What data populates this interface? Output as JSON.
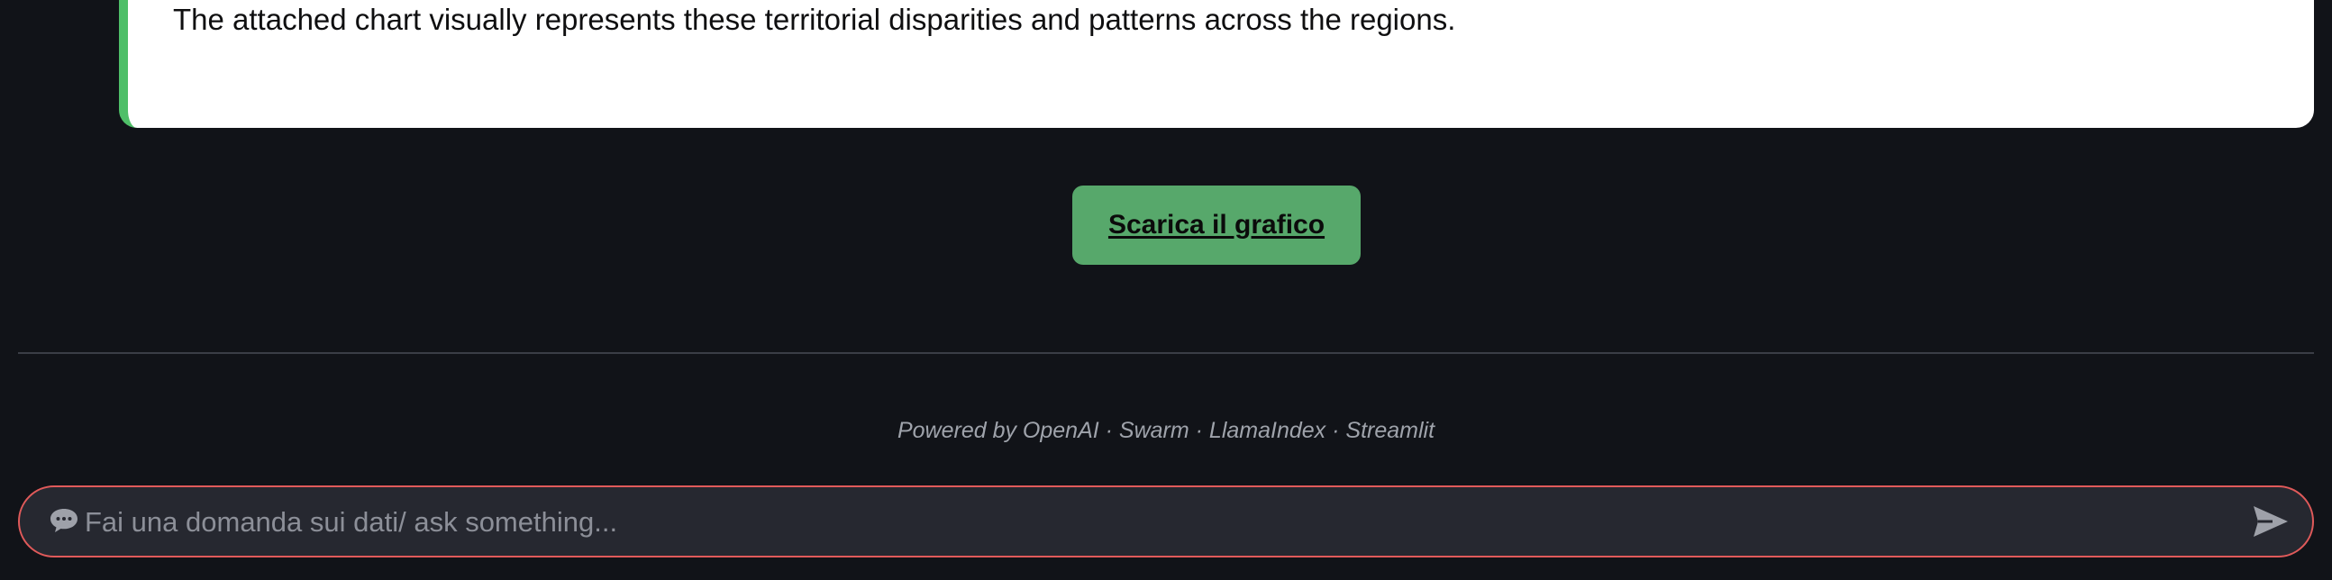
{
  "message": {
    "text": "The attached chart visually represents these territorial disparities and patterns across the regions."
  },
  "actions": {
    "download_label": "Scarica il grafico"
  },
  "footer": {
    "powered_by": "Powered by OpenAI · Swarm · LlamaIndex · Streamlit"
  },
  "chat_input": {
    "placeholder": "Fai una domanda sui dati/ ask something...",
    "value": ""
  },
  "icons": {
    "chat": "speech-bubble-icon",
    "send": "send-icon"
  },
  "colors": {
    "background": "#111318",
    "accent_green": "#57a86b",
    "card_border_green": "#4fbf68",
    "input_border": "#e05a5a"
  }
}
